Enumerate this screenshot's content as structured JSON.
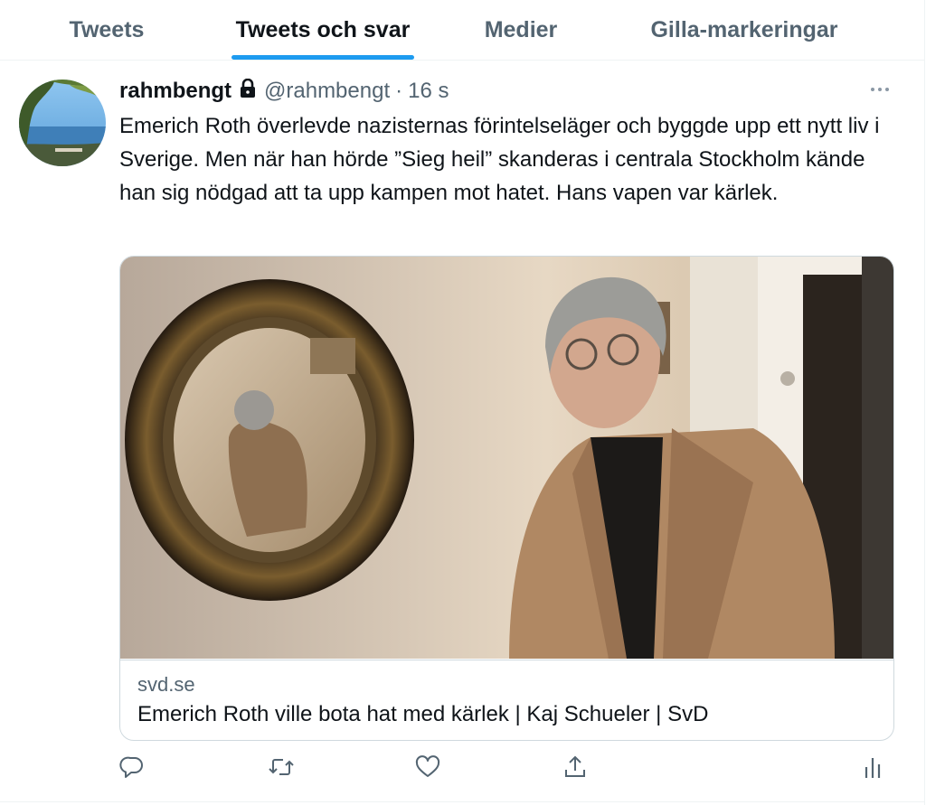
{
  "tabs": [
    {
      "label": "Tweets",
      "active": false
    },
    {
      "label": "Tweets och svar",
      "active": true
    },
    {
      "label": "Medier",
      "active": false
    },
    {
      "label": "Gilla-markeringar",
      "active": false
    }
  ],
  "colors": {
    "accent": "#1d9bf0",
    "secondary_text": "#536471",
    "border": "#cfd9de"
  },
  "tweet": {
    "display_name": "rahmbengt",
    "protected_icon": "lock-icon",
    "handle": "@rahmbengt",
    "separator": "·",
    "time": "16 s",
    "text": "Emerich Roth överlevde nazisternas förintelseläger och byggde upp ett nytt liv i Sverige. Men när han hörde ”Sieg heil” skanderas i centrala Stockholm kände han sig nödgad att ta upp kampen mot hatet. Hans vapen var kärlek.",
    "card": {
      "domain": "svd.se",
      "title": "Emerich Roth ville bota hat med kärlek | Kaj Schueler | SvD"
    },
    "actions": [
      "reply-icon",
      "retweet-icon",
      "like-icon",
      "share-icon",
      "analytics-icon"
    ]
  }
}
